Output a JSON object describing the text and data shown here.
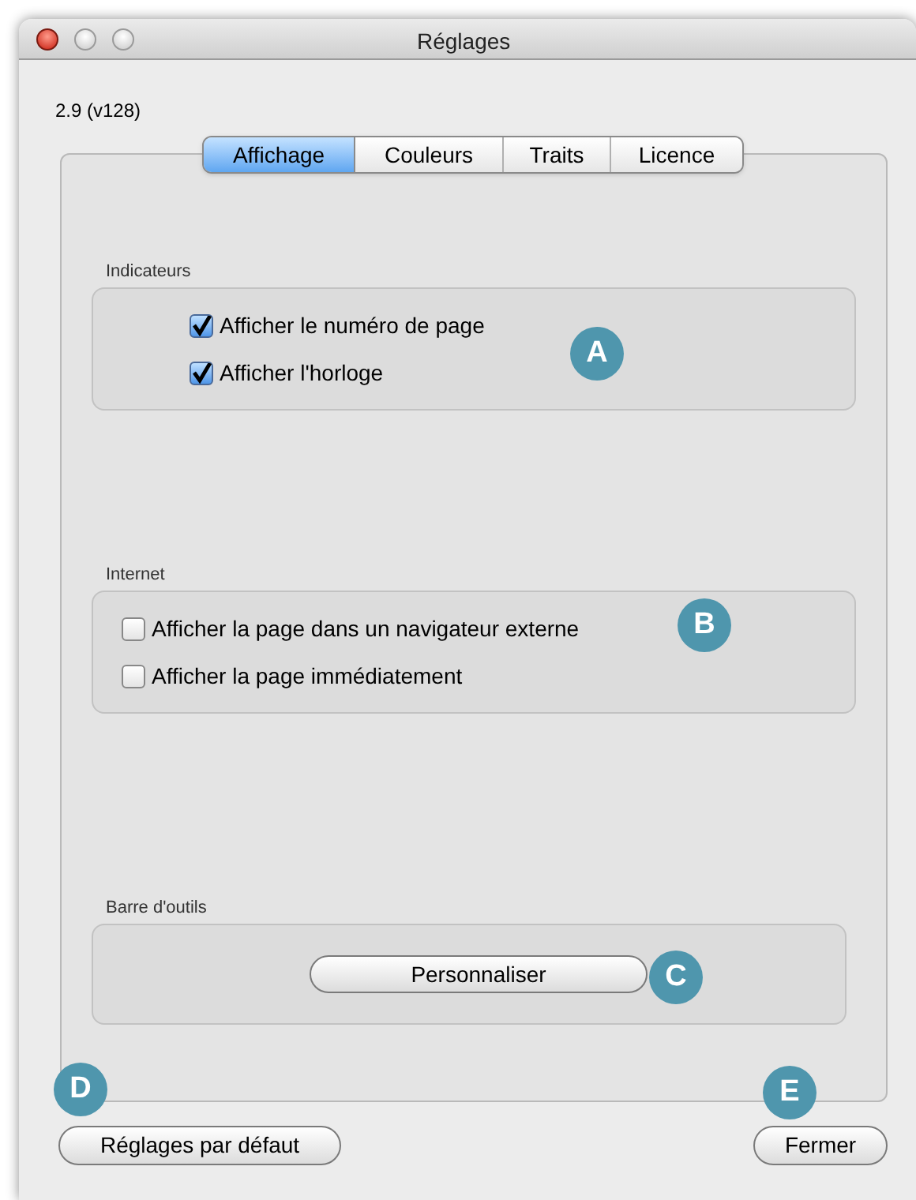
{
  "window": {
    "title": "Réglages"
  },
  "version": "2.9 (v128)",
  "tabs": [
    {
      "label": "Affichage",
      "selected": true
    },
    {
      "label": "Couleurs",
      "selected": false
    },
    {
      "label": "Traits",
      "selected": false
    },
    {
      "label": "Licence",
      "selected": false
    }
  ],
  "groups": [
    {
      "title": "Indicateurs",
      "kind": "checks",
      "indented": true,
      "items": [
        {
          "label": "Afficher le numéro de page",
          "checked": true
        },
        {
          "label": "Afficher l'horloge",
          "checked": true
        }
      ],
      "callout": "A"
    },
    {
      "title": "Internet",
      "kind": "checks",
      "indented": false,
      "items": [
        {
          "label": "Afficher la page dans un navigateur externe",
          "checked": false
        },
        {
          "label": "Afficher la page immédiatement",
          "checked": false
        }
      ],
      "callout": "B"
    },
    {
      "title": "Barre d'outils",
      "kind": "button",
      "button": "Personnaliser",
      "callout": "C"
    }
  ],
  "footer": {
    "left_button": "Réglages par défaut",
    "left_callout": "D",
    "right_button": "Fermer",
    "right_callout": "E"
  }
}
